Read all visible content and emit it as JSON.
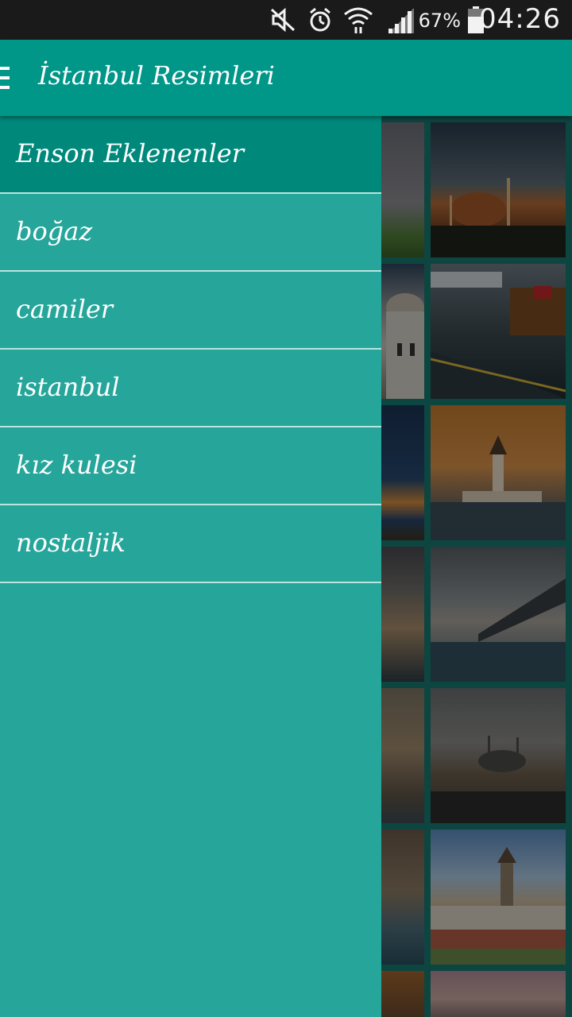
{
  "status_bar": {
    "icons": [
      "mute-icon",
      "alarm-icon",
      "wifi-icon",
      "signal-icon",
      "battery-icon"
    ],
    "battery_percent": "67%",
    "time": "04:26"
  },
  "app_bar": {
    "title": "İstanbul Resimleri",
    "menu_icon": "hamburger-menu-icon"
  },
  "drawer": {
    "items": [
      {
        "label": "Enson Eklenenler",
        "selected": true
      },
      {
        "label": "boğaz",
        "selected": false
      },
      {
        "label": "camiler",
        "selected": false
      },
      {
        "label": "istanbul",
        "selected": false
      },
      {
        "label": "kız kulesi",
        "selected": false
      },
      {
        "label": "nostaljik",
        "selected": false
      }
    ]
  },
  "colors": {
    "primary": "#009688",
    "drawer_bg": "#26a69a",
    "drawer_selected": "#00897b",
    "status_bar": "#1a1a1a",
    "divider": "#b9e4df"
  }
}
